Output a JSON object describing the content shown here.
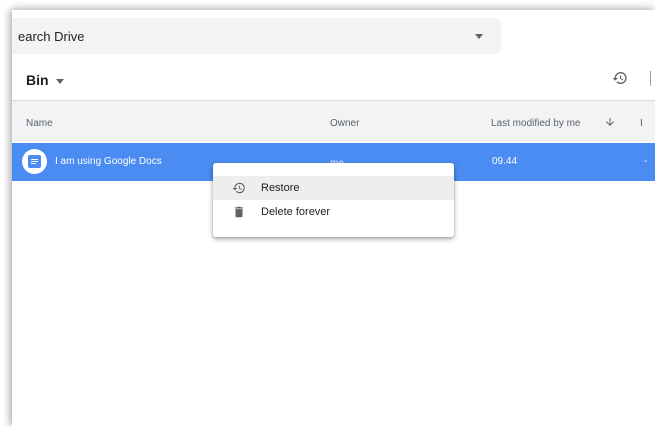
{
  "search": {
    "text": "earch Drive"
  },
  "header": {
    "title": "Bin",
    "history_icon": "history-icon"
  },
  "columns": {
    "name": "Name",
    "owner": "Owner",
    "last_modified": "Last modified by me",
    "extra": "I",
    "sort_icon": "arrow-down-icon"
  },
  "row": {
    "name": "I am using Google Docs",
    "owner": "me",
    "last_modified": "09.44",
    "extra": "-",
    "icon": "google-docs-icon"
  },
  "context_menu": {
    "items": [
      {
        "label": "Restore",
        "icon": "history-icon"
      },
      {
        "label": "Delete forever",
        "icon": "trash-icon"
      }
    ]
  },
  "colors": {
    "selection": "#4a8cf1",
    "search_bg": "#f1f3f4",
    "header_bg": "#f1f3f4",
    "menu_hover": "#eeeeee",
    "icon_grey": "#5f6368"
  }
}
